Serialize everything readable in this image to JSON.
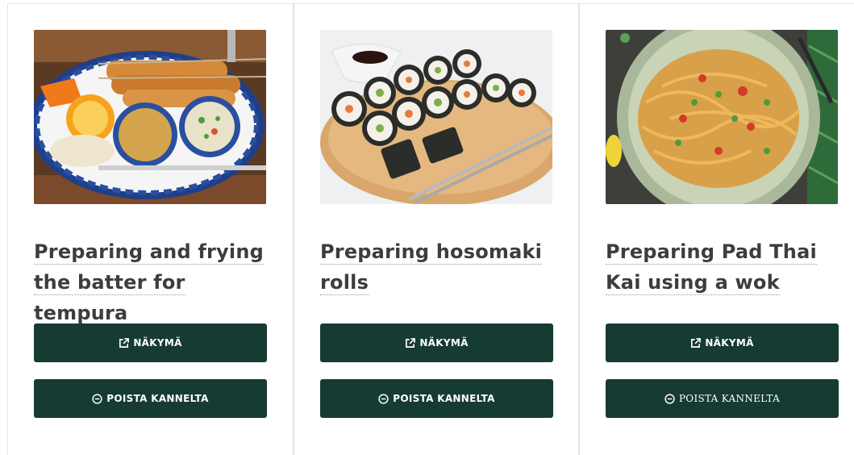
{
  "cards": [
    {
      "title": "Preparing and frying the batter for tempura",
      "image_alt": "Fried tempura with dipping sauces on a blue patterned plate",
      "view_label": "NÄKYMÄ",
      "remove_label": "POISTA KANNELTA"
    },
    {
      "title": "Preparing hosomaki rolls",
      "image_alt": "Hosomaki sushi rolls on a wooden board with chopsticks and soy sauce",
      "view_label": "NÄKYMÄ",
      "remove_label": "POISTA KANNELTA"
    },
    {
      "title": "Preparing Pad Thai Kai using a wok",
      "image_alt": "Pad Thai noodles in a green bowl",
      "view_label": "NÄKYMÄ",
      "remove_label": "POISTA KANNELTA"
    }
  ],
  "icons": {
    "view": "external-link-icon",
    "remove": "minus-circle-icon"
  },
  "colors": {
    "button_bg": "#163b33",
    "button_text": "#ffffff",
    "title": "#3d3d3d"
  }
}
